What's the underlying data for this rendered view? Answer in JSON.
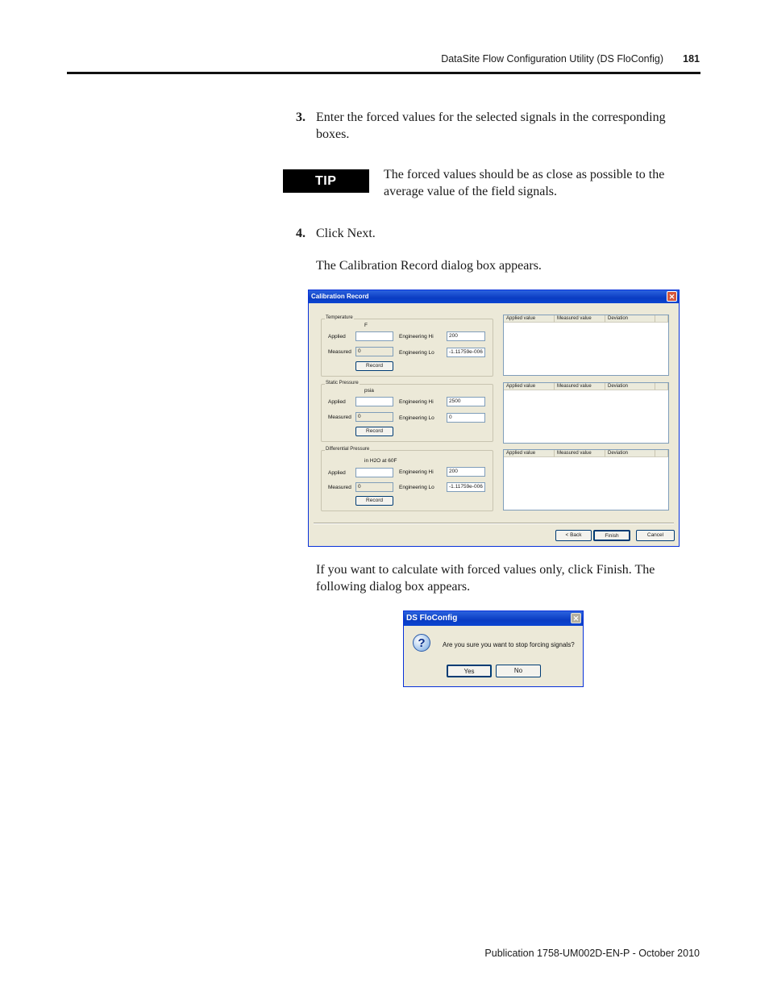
{
  "header": {
    "title": "DataSite Flow Configuration Utility (DS FloConfig)",
    "page": "181"
  },
  "steps": [
    {
      "num": "3.",
      "text_line1": "Enter the forced values for the selected signals in the corresponding",
      "text_line2": "boxes."
    },
    {
      "num": "4.",
      "text": "Click Next."
    }
  ],
  "tip": {
    "label": "TIP",
    "line1": "The forced values should be as close as possible to the",
    "line2": "average value of the field signals."
  },
  "para_calib": "The Calibration Record dialog box appears.",
  "para_finish_1": "If you want to calculate with forced values only, click Finish. The",
  "para_finish_2": "following dialog box appears.",
  "calib_dialog": {
    "title": "Calibration Record",
    "close": "✕",
    "groups": [
      {
        "name": "Temperature",
        "unit": "F",
        "applied_label": "Applied",
        "applied": "",
        "measured_label": "Measured",
        "measured": "0",
        "hi_label": "Engineering Hi",
        "hi": "200",
        "lo_label": "Engineering Lo",
        "lo": "-1.11759e-006",
        "record": "Record"
      },
      {
        "name": "Static Pressure",
        "unit": "psia",
        "applied_label": "Applied",
        "applied": "",
        "measured_label": "Measured",
        "measured": "0",
        "hi_label": "Engineering Hi",
        "hi": "2500",
        "lo_label": "Engineering Lo",
        "lo": "0",
        "record": "Record"
      },
      {
        "name": "Differential Pressure",
        "unit": "in H2O at 60F",
        "applied_label": "Applied",
        "applied": "",
        "measured_label": "Measured",
        "measured": "0",
        "hi_label": "Engineering Hi",
        "hi": "200",
        "lo_label": "Engineering Lo",
        "lo": "-1.11759e-006",
        "record": "Record"
      }
    ],
    "columns": [
      "Applied value",
      "Measured value",
      "Deviation"
    ],
    "buttons": {
      "back": "< Back",
      "finish": "Finish",
      "cancel": "Cancel"
    }
  },
  "confirm_dialog": {
    "title": "DS FloConfig",
    "close": "✕",
    "icon": "?",
    "message": "Are you sure you want to stop forcing signals?",
    "yes": "Yes",
    "no": "No"
  },
  "footer": "Publication 1758-UM002D-EN-P - October 2010"
}
